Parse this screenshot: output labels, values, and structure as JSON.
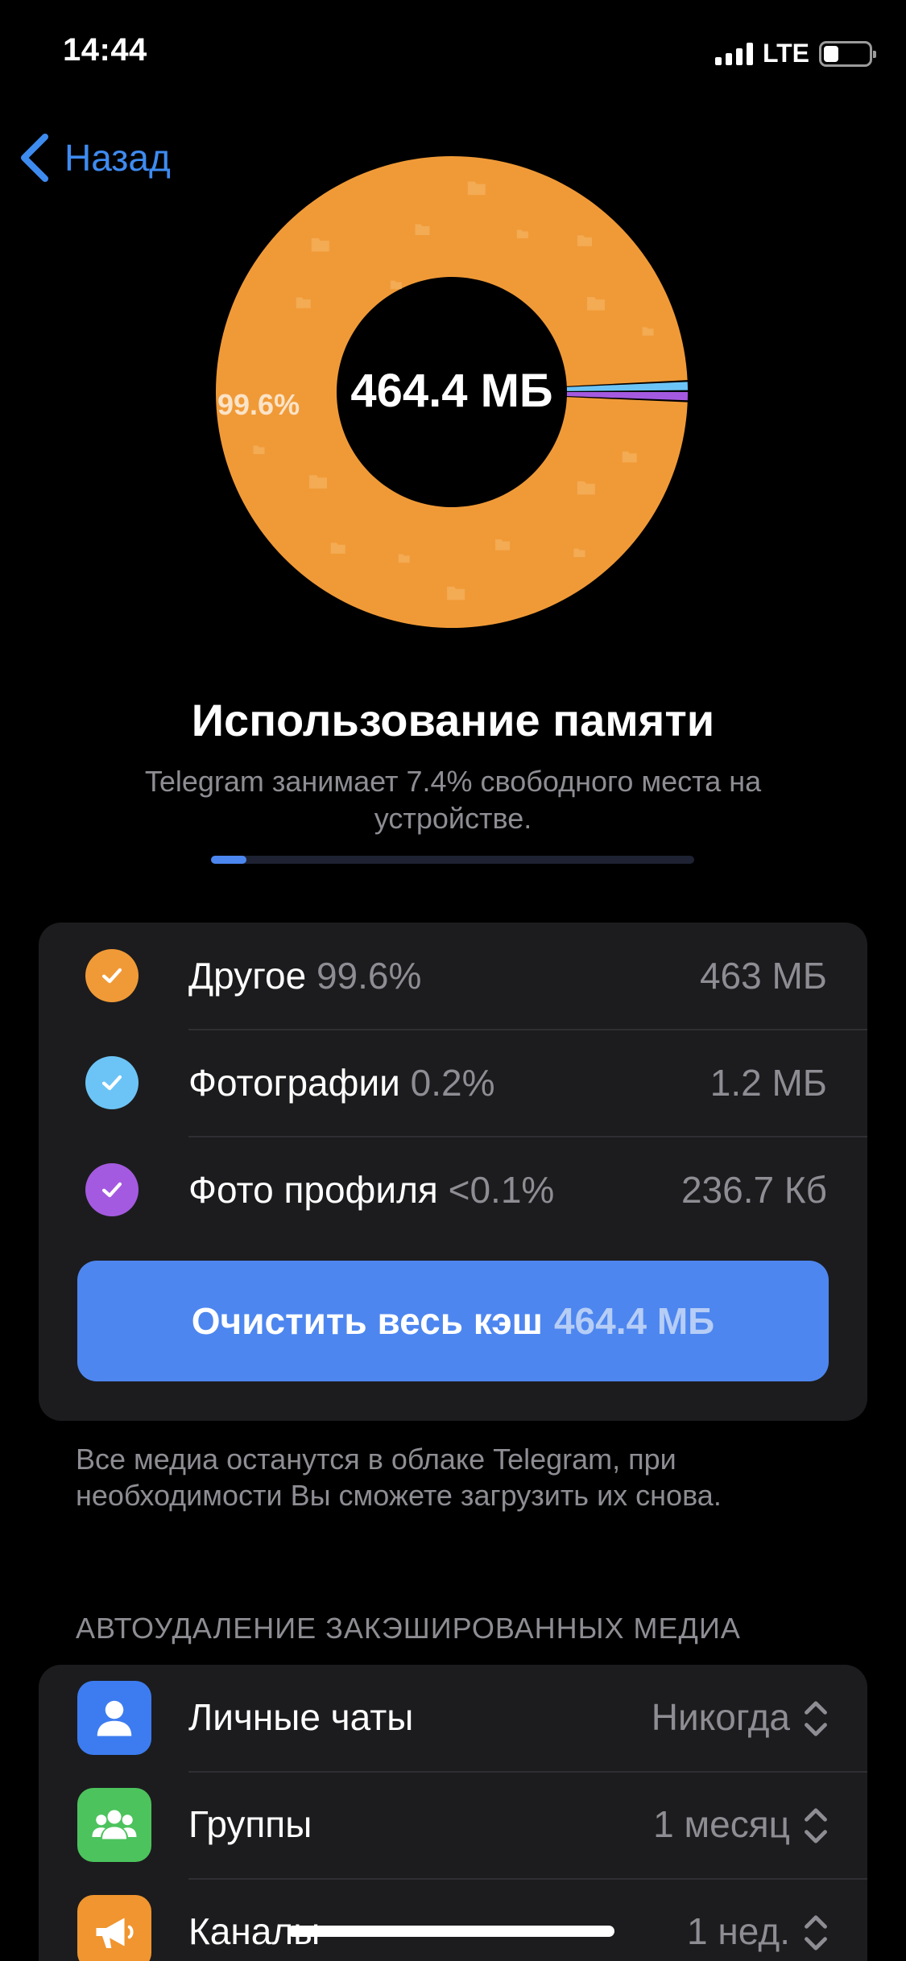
{
  "status_bar": {
    "time": "14:44",
    "network": "LTE",
    "battery_level": 0.34
  },
  "nav": {
    "back_label": "Назад"
  },
  "chart_data": {
    "type": "pie",
    "center_label": "464.4 МБ",
    "slice_label": "99.6%",
    "slices": [
      {
        "name": "Другое",
        "value": 99.6,
        "color": "#f09a37"
      },
      {
        "name": "Фотографии",
        "value": 0.2,
        "color": "#6cc4f6"
      },
      {
        "name": "Фото профиля",
        "value": 0.1,
        "color": "#a45ae0"
      }
    ]
  },
  "header": {
    "title": "Использование памяти",
    "subtitle": "Telegram занимает 7.4% свободного места на устройстве.",
    "usage_fraction": 0.074
  },
  "storage": {
    "items": [
      {
        "label": "Другое",
        "pct": "99.6%",
        "size": "463 МБ",
        "color": "#f09a37"
      },
      {
        "label": "Фотографии",
        "pct": "0.2%",
        "size": "1.2 МБ",
        "color": "#6cc4f6"
      },
      {
        "label": "Фото профиля",
        "pct": "<0.1%",
        "size": "236.7 Кб",
        "color": "#a45ae0"
      }
    ],
    "clear_button": {
      "label": "Очистить весь кэш",
      "size": "464.4 МБ"
    },
    "note": "Все медиа останутся в облаке Telegram, при необходимости Вы сможете загрузить их снова."
  },
  "auto_delete": {
    "header": "АВТОУДАЛЕНИЕ ЗАКЭШИРОВАННЫХ МЕДИА",
    "items": [
      {
        "label": "Личные чаты",
        "value": "Никогда",
        "icon": "person-icon",
        "color": "#3d7cf0"
      },
      {
        "label": "Группы",
        "value": "1 месяц",
        "icon": "group-icon",
        "color": "#4cc35d"
      },
      {
        "label": "Каналы",
        "value": "1 нед.",
        "icon": "megaphone-icon",
        "color": "#f0952f"
      }
    ]
  }
}
